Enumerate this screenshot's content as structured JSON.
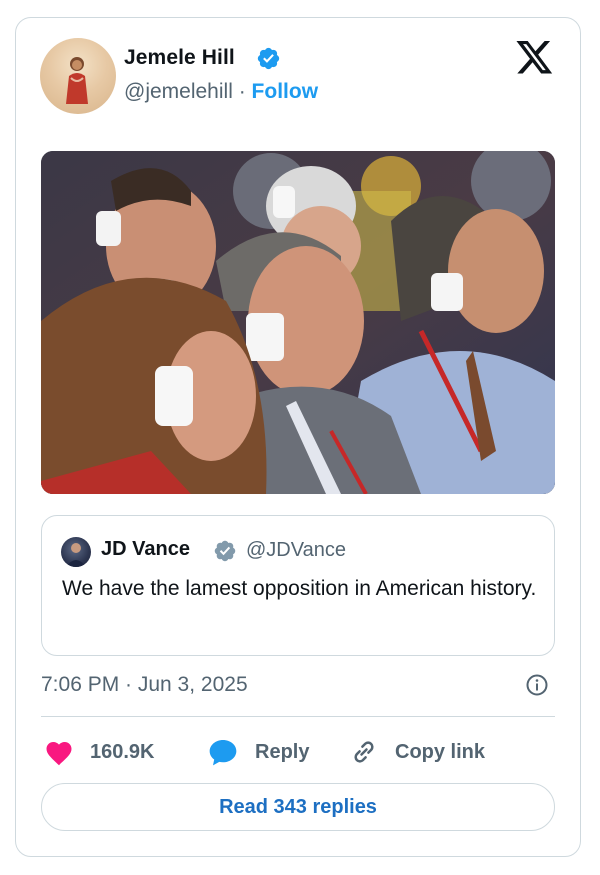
{
  "author": {
    "name": "Jemele Hill",
    "handle": "@jemelehill",
    "separator": "·",
    "follow_label": "Follow",
    "verified_icon": "verified-badge-icon",
    "logo_icon": "x-logo-icon"
  },
  "photo": {
    "icon": "photo-people-with-ear-bandages"
  },
  "quote": {
    "name": "JD Vance",
    "handle": "@JDVance",
    "text": "We have the lamest opposition in American history.",
    "verified_icon": "verified-badge-gray-icon"
  },
  "meta": {
    "timestamp": "7:06 PM · Jun 3, 2025",
    "info_icon": "info-icon"
  },
  "actions": {
    "likes": "160.9K",
    "reply_label": "Reply",
    "copy_label": "Copy link"
  },
  "footer": {
    "read_replies_label": "Read 343 replies"
  },
  "colors": {
    "accent": "#1d9bf0",
    "like": "#f91880",
    "muted": "#536471",
    "border": "#cfd9de"
  }
}
